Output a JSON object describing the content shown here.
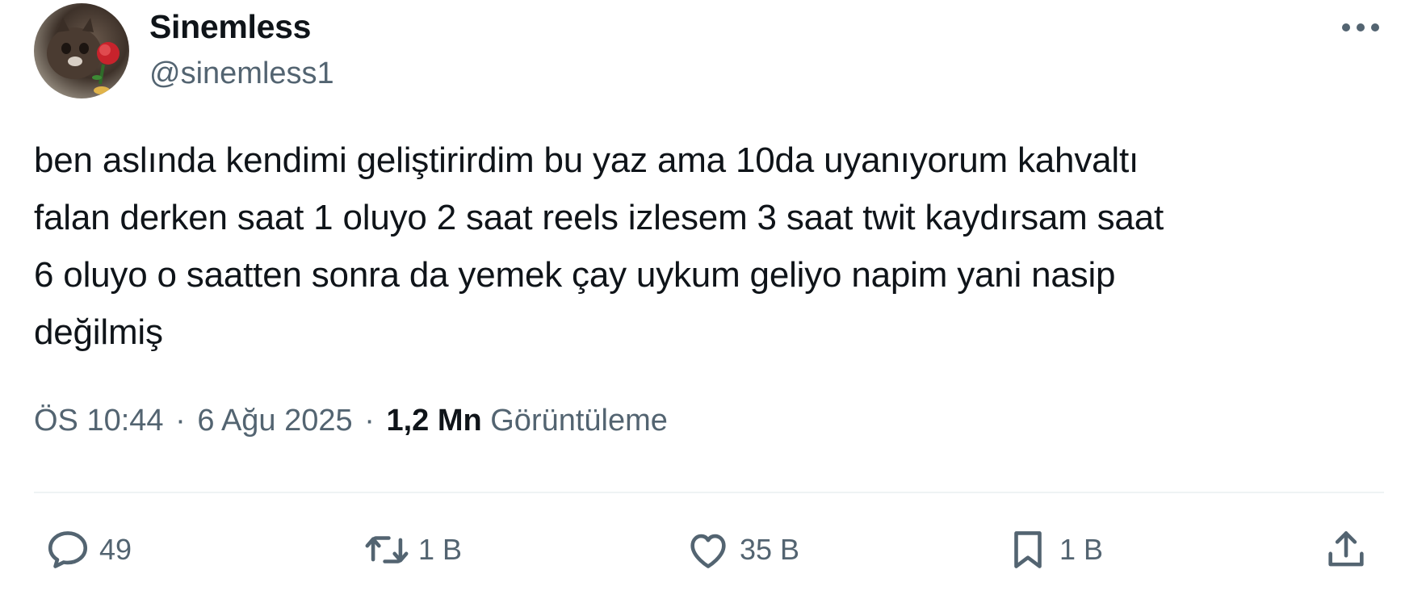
{
  "author": {
    "display_name": "Sinemless",
    "handle": "@sinemless1"
  },
  "tweet": {
    "text": "ben aslında kendimi geliştirirdim bu yaz ama 10da uyanıyorum kahvaltı\nfalan derken saat 1 oluyo 2 saat reels izlesem 3 saat twit kaydırsam saat\n6 oluyo o saatten sonra da yemek çay uykum geliyo napim yani nasip\ndeğilmiş"
  },
  "meta": {
    "time": "ÖS 10:44",
    "separator": "·",
    "date": "6 Ağu 2025",
    "views_count": "1,2 Mn",
    "views_label": "Görüntüleme"
  },
  "actions": {
    "reply": {
      "icon": "reply-icon",
      "count": "49"
    },
    "retweet": {
      "icon": "retweet-icon",
      "count": "1 B"
    },
    "like": {
      "icon": "heart-icon",
      "count": "35 B"
    },
    "bookmark": {
      "icon": "bookmark-icon",
      "count": "1 B"
    },
    "share": {
      "icon": "share-icon"
    }
  },
  "colors": {
    "text_primary": "#0f1419",
    "text_secondary": "#536471",
    "divider": "#eff3f4"
  }
}
